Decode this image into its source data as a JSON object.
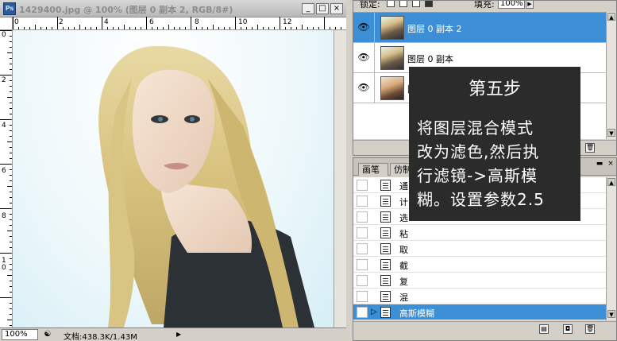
{
  "document": {
    "title": "1429400.jpg @ 100% (图层 0 副本 2, RGB/8#)",
    "app_icon": "Ps",
    "window_buttons": {
      "minimize": "_",
      "maximize": "□",
      "close": "×"
    },
    "ruler_top_labels": [
      "0",
      "2",
      "4",
      "6",
      "8",
      "10",
      "12"
    ],
    "ruler_left_labels": [
      "0",
      "2",
      "4",
      "6",
      "8",
      "1\n0"
    ],
    "status": {
      "zoom": "100%",
      "doc_size": "文档:438.3K/1.43M",
      "icon": "nav-icon"
    }
  },
  "layers": {
    "lock_label": "锁定:",
    "fill_label": "填充:",
    "fill_value": "100%",
    "items": [
      {
        "name": "图层 0 副本 2",
        "selected": true
      },
      {
        "name": "图层 0 副本",
        "selected": false
      },
      {
        "name": "图",
        "selected": false
      }
    ]
  },
  "history": {
    "tabs": [
      "画笔",
      "仿制"
    ],
    "items": [
      {
        "label": "通",
        "selected": false
      },
      {
        "label": "计",
        "selected": false
      },
      {
        "label": "选",
        "selected": false
      },
      {
        "label": "粘",
        "selected": false
      },
      {
        "label": "取",
        "selected": false
      },
      {
        "label": "截",
        "selected": false
      },
      {
        "label": "复",
        "selected": false
      },
      {
        "label": "混",
        "selected": false
      },
      {
        "label": "高斯模糊",
        "selected": true
      }
    ]
  },
  "overlay": {
    "title": "第五步",
    "lines": [
      "将图层混合模式",
      "改为滤色,然后执",
      "行滤镜->高斯模",
      "糊。设置参数2.5"
    ]
  },
  "colors": {
    "selection": "#3c8fd4",
    "overlay_bg": "#2b2b2b",
    "panel_bg": "#d4d0c8"
  }
}
